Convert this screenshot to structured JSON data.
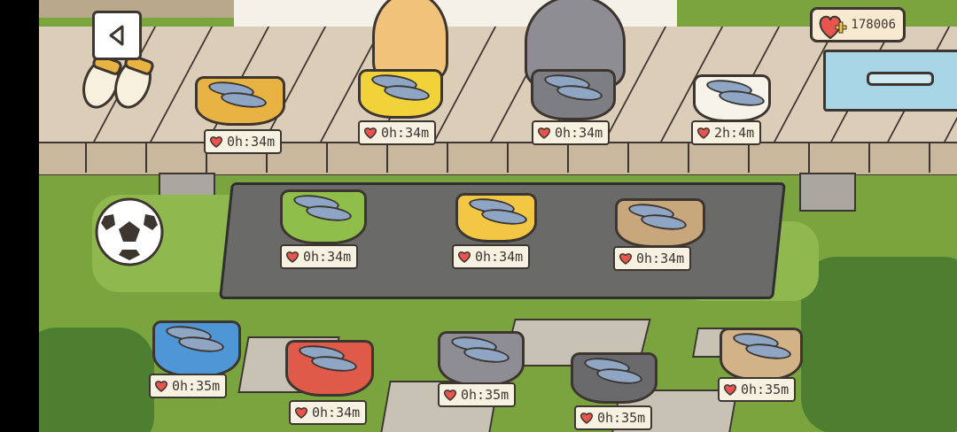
{
  "hud": {
    "back_icon": "back-arrow-icon",
    "currency_icon": "heart-plus-icon",
    "currency_value": "178006"
  },
  "colors": {
    "grass": "#7aa53e",
    "deck": "#dbcdb8",
    "outline": "#3d3530",
    "label_bg": "#f7f1e1",
    "heart": "#e8554e"
  },
  "food_slots": [
    {
      "id": "deck-1",
      "timer": "0h:34m"
    },
    {
      "id": "deck-2",
      "timer": "0h:34m"
    },
    {
      "id": "deck-3",
      "timer": "0h:34m"
    },
    {
      "id": "deck-4",
      "timer": "2h:4m"
    },
    {
      "id": "stone-1",
      "timer": "0h:34m"
    },
    {
      "id": "stone-2",
      "timer": "0h:34m"
    },
    {
      "id": "stone-3",
      "timer": "0h:34m"
    },
    {
      "id": "lawn-1",
      "timer": "0h:35m"
    },
    {
      "id": "lawn-2",
      "timer": "0h:34m"
    },
    {
      "id": "lawn-3",
      "timer": "0h:35m"
    },
    {
      "id": "lawn-4",
      "timer": "0h:35m"
    },
    {
      "id": "lawn-5",
      "timer": "0h:35m"
    }
  ]
}
